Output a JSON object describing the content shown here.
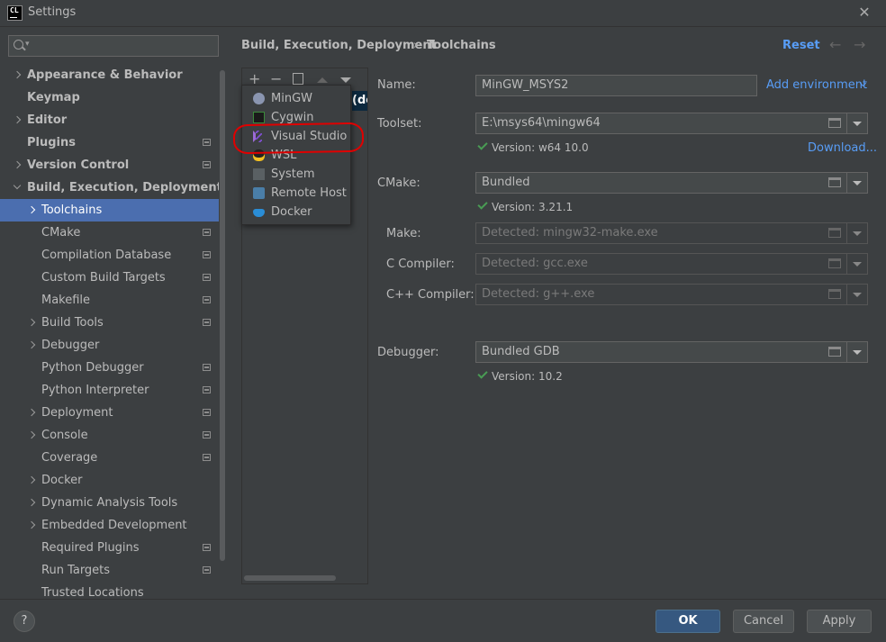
{
  "window": {
    "title": "Settings",
    "app_icon_text": "CL"
  },
  "search": {
    "placeholder": ""
  },
  "sidebar": {
    "items": [
      {
        "label": "Appearance & Behavior",
        "level": 0,
        "arrow": "right",
        "bold": true,
        "proj": false
      },
      {
        "label": "Keymap",
        "level": 0,
        "arrow": "none",
        "bold": true,
        "proj": false
      },
      {
        "label": "Editor",
        "level": 0,
        "arrow": "right",
        "bold": true,
        "proj": false
      },
      {
        "label": "Plugins",
        "level": 0,
        "arrow": "none",
        "bold": true,
        "proj": true
      },
      {
        "label": "Version Control",
        "level": 0,
        "arrow": "right",
        "bold": true,
        "proj": true
      },
      {
        "label": "Build, Execution, Deployment",
        "level": 0,
        "arrow": "down",
        "bold": true,
        "proj": false
      },
      {
        "label": "Toolchains",
        "level": 1,
        "arrow": "right",
        "bold": false,
        "proj": false,
        "selected": true
      },
      {
        "label": "CMake",
        "level": 1,
        "arrow": "none",
        "bold": false,
        "proj": true
      },
      {
        "label": "Compilation Database",
        "level": 1,
        "arrow": "none",
        "bold": false,
        "proj": true
      },
      {
        "label": "Custom Build Targets",
        "level": 1,
        "arrow": "none",
        "bold": false,
        "proj": true
      },
      {
        "label": "Makefile",
        "level": 1,
        "arrow": "none",
        "bold": false,
        "proj": true
      },
      {
        "label": "Build Tools",
        "level": 1,
        "arrow": "right",
        "bold": false,
        "proj": true
      },
      {
        "label": "Debugger",
        "level": 1,
        "arrow": "right",
        "bold": false,
        "proj": false
      },
      {
        "label": "Python Debugger",
        "level": 1,
        "arrow": "none",
        "bold": false,
        "proj": true
      },
      {
        "label": "Python Interpreter",
        "level": 1,
        "arrow": "none",
        "bold": false,
        "proj": true
      },
      {
        "label": "Deployment",
        "level": 1,
        "arrow": "right",
        "bold": false,
        "proj": true
      },
      {
        "label": "Console",
        "level": 1,
        "arrow": "right",
        "bold": false,
        "proj": true
      },
      {
        "label": "Coverage",
        "level": 1,
        "arrow": "none",
        "bold": false,
        "proj": true
      },
      {
        "label": "Docker",
        "level": 1,
        "arrow": "right",
        "bold": false,
        "proj": false
      },
      {
        "label": "Dynamic Analysis Tools",
        "level": 1,
        "arrow": "right",
        "bold": false,
        "proj": false
      },
      {
        "label": "Embedded Development",
        "level": 1,
        "arrow": "right",
        "bold": false,
        "proj": false
      },
      {
        "label": "Required Plugins",
        "level": 1,
        "arrow": "none",
        "bold": false,
        "proj": true
      },
      {
        "label": "Run Targets",
        "level": 1,
        "arrow": "none",
        "bold": false,
        "proj": true
      },
      {
        "label": "Trusted Locations",
        "level": 1,
        "arrow": "none",
        "bold": false,
        "proj": false
      }
    ]
  },
  "header": {
    "breadcrumb_parent": "Build, Execution, Deployment",
    "breadcrumb_separator": "›",
    "breadcrumb_current": "Toolchains",
    "reset_label": "Reset"
  },
  "toolchain_list": {
    "toolbar": [
      "+",
      "−",
      "copy",
      "up",
      "down"
    ],
    "entry_text": "(de"
  },
  "add_menu": {
    "items": [
      {
        "label": "MinGW",
        "icon": "gnu-icon"
      },
      {
        "label": "Cygwin",
        "icon": "cygwin-icon"
      },
      {
        "label": "Visual Studio",
        "icon": "visual-studio-icon"
      },
      {
        "label": "WSL",
        "icon": "linux-penguin-icon"
      },
      {
        "label": "System",
        "icon": "terminal-icon"
      },
      {
        "label": "Remote Host",
        "icon": "remote-host-icon"
      },
      {
        "label": "Docker",
        "icon": "docker-icon"
      }
    ]
  },
  "form": {
    "name_label": "Name:",
    "name_value": "MinGW_MSYS2",
    "add_environment_label": "Add environment",
    "toolset_label": "Toolset:",
    "toolset_value": "E:\\msys64\\mingw64",
    "toolset_version": "Version: w64 10.0",
    "download_label": "Download...",
    "cmake_label": "CMake:",
    "cmake_value": "Bundled",
    "cmake_version": "Version: 3.21.1",
    "make_label": "Make:",
    "make_placeholder": "Detected: mingw32-make.exe",
    "c_compiler_label": "C Compiler:",
    "c_compiler_placeholder": "Detected: gcc.exe",
    "cpp_compiler_label": "C++ Compiler:",
    "cpp_compiler_placeholder": "Detected: g++.exe",
    "debugger_label": "Debugger:",
    "debugger_value": "Bundled GDB",
    "debugger_version": "Version: 10.2"
  },
  "footer": {
    "help_label": "?",
    "ok_label": "OK",
    "cancel_label": "Cancel",
    "apply_label": "Apply"
  },
  "colors": {
    "background": "#3c3f41",
    "selection": "#4b6eaf",
    "link": "#589df6",
    "ok_button": "#365880",
    "check": "#499c54",
    "highlight_ring": "#e00000"
  }
}
